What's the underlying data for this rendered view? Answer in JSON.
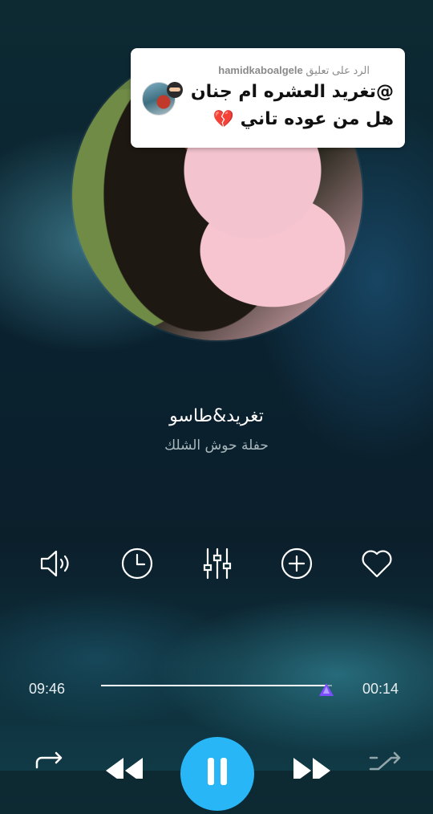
{
  "comment": {
    "reply_prefix": "الرد على تعليق",
    "username": "hamidkaboalgele",
    "line1": "@تغريد العشره ام جنان",
    "line2": "هل من عوده تاني",
    "line2_emoji": "💔"
  },
  "track": {
    "title": "تغريد&طاسو",
    "subtitle": "حفلة حوش الشلك"
  },
  "player": {
    "elapsed": "09:46",
    "total": "00:14",
    "progress_fraction": 0.98
  },
  "colors": {
    "accent": "#29b6f6",
    "thumb": "#7c4dff"
  },
  "icons": [
    "volume-icon",
    "sleep-timer-icon",
    "equalizer-icon",
    "add-icon",
    "favorite-icon",
    "repeat-icon",
    "previous-icon",
    "pause-icon",
    "next-icon",
    "shuffle-icon"
  ]
}
